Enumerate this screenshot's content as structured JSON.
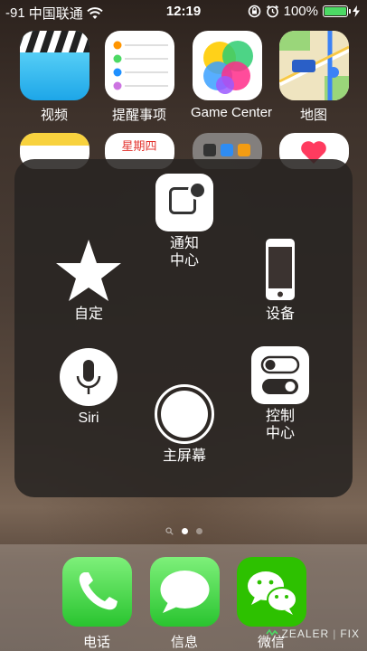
{
  "status": {
    "signal": "-91",
    "carrier": "中国联通",
    "time": "12:19",
    "battery_text": "100%"
  },
  "apps_row1": [
    {
      "label": "视频",
      "icon": "video-icon"
    },
    {
      "label": "提醒事项",
      "icon": "reminders-icon"
    },
    {
      "label": "Game Center",
      "icon": "game-center-icon"
    },
    {
      "label": "地图",
      "icon": "maps-icon"
    }
  ],
  "apps_row2_calendar_header": "星期四",
  "assistive": {
    "notification": "通知\n中心",
    "device": "设备",
    "custom": "自定",
    "siri": "Siri",
    "control": "控制\n中心",
    "home": "主屏幕"
  },
  "dock": [
    {
      "label": "电话",
      "icon": "phone-icon"
    },
    {
      "label": "信息",
      "icon": "messages-icon"
    },
    {
      "label": "微信",
      "icon": "wechat-icon"
    }
  ],
  "watermark": {
    "left": "ZEALER",
    "right": "FIX"
  },
  "colors": {
    "battery_fill": "#4cd964",
    "phone": "#4cd964",
    "wechat": "#2dc100"
  }
}
